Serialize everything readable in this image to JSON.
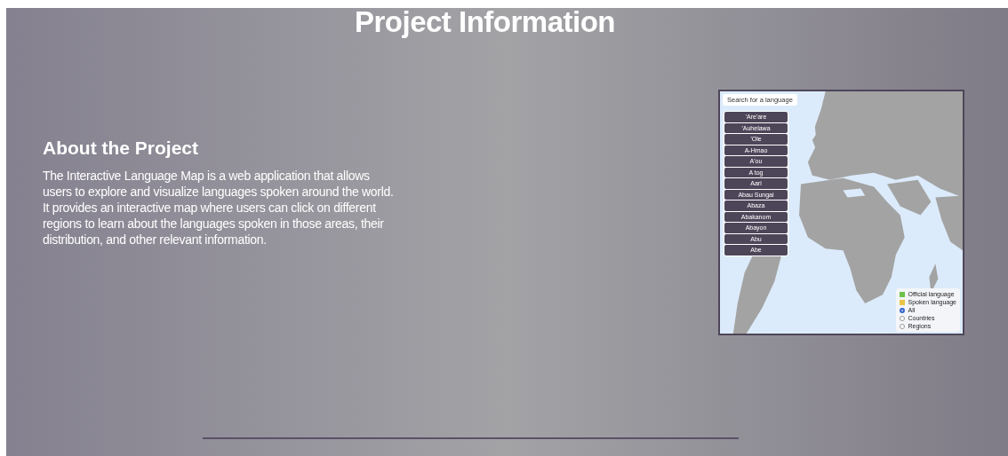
{
  "title": "Project Information",
  "about": {
    "heading": "About the Project",
    "text": "The Interactive Language Map is a web application that allows users to explore and visualize languages spoken around the world. It provides an interactive map where users can click on different regions to learn about the languages spoken in those areas, their distribution, and other relevant information."
  },
  "map_screenshot": {
    "search": {
      "placeholder": "Search for a language"
    },
    "languages": [
      "'Are'are",
      "'Auhelawa",
      "'Ole",
      "A-Hmao",
      "A'ou",
      "A tog",
      "Aari",
      "Abau Sungai",
      "Abaza",
      "Abakanom",
      "Abayon",
      "Abu",
      "Abe"
    ],
    "legend": [
      {
        "label": "Official language",
        "color": "#6cc24a"
      },
      {
        "label": "Spoken language",
        "color": "#e8c547"
      }
    ],
    "filters": [
      {
        "label": "All",
        "selected": true
      },
      {
        "label": "Countries",
        "selected": false
      },
      {
        "label": "Regions",
        "selected": false
      }
    ]
  }
}
